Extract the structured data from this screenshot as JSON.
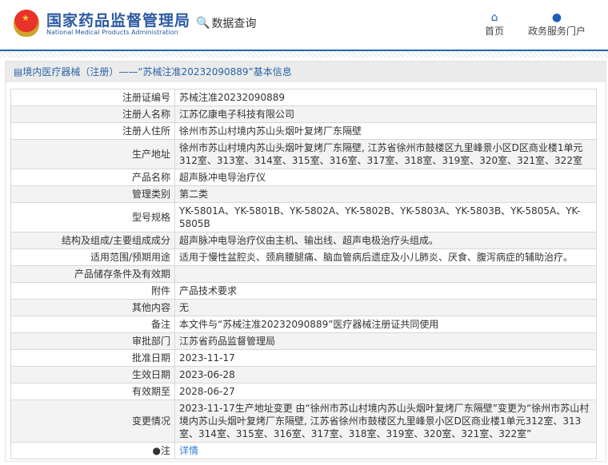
{
  "header": {
    "logo_cn": "国家药品监督管理局",
    "logo_en": "National Medical Products Administration",
    "data_query": "数据查询",
    "nav": [
      {
        "label": "首页",
        "icon": "home-icon"
      },
      {
        "label": "政务服务门户",
        "icon": "user-icon"
      }
    ]
  },
  "panel": {
    "title": "境内医疗器械（注册）——“苏械注准20232090889”基本信息"
  },
  "rows": [
    {
      "label": "注册证编号",
      "value": "苏械注准20232090889"
    },
    {
      "label": "注册人名称",
      "value": "江苏亿康电子科技有限公司"
    },
    {
      "label": "注册人住所",
      "value": "徐州市苏山村境内苏山头烟叶复烤厂东隔壁"
    },
    {
      "label": "生产地址",
      "value": "徐州市苏山村境内苏山头烟叶复烤厂东隔壁, 江苏省徐州市鼓楼区九里峰景小区D区商业楼1单元312室、313室、314室、315室、316室、317室、318室、319室、320室、321室、322室"
    },
    {
      "label": "产品名称",
      "value": "超声脉冲电导治疗仪"
    },
    {
      "label": "管理类别",
      "value": "第二类"
    },
    {
      "label": "型号规格",
      "value": "YK-5801A、YK-5801B、YK-5802A、YK-5802B、YK-5803A、YK-5803B、YK-5805A、YK-5805B"
    },
    {
      "label": "结构及组成/主要组成成分",
      "value": "超声脉冲电导治疗仪由主机、输出线、超声电极治疗头组成。"
    },
    {
      "label": "适用范围/预期用途",
      "value": "适用于慢性盆腔炎、颈肩腰腿痛、脑血管病后遗症及小儿肺炎、厌食、腹泻病症的辅助治疗。"
    },
    {
      "label": "产品储存条件及有效期",
      "value": ""
    },
    {
      "label": "附件",
      "value": "产品技术要求"
    },
    {
      "label": "其他内容",
      "value": "无"
    },
    {
      "label": "备注",
      "value": "本文件与“苏械注准20232090889”医疗器械注册证共同使用"
    },
    {
      "label": "审批部门",
      "value": "江苏省药品监督管理局"
    },
    {
      "label": "批准日期",
      "value": "2023-11-17"
    },
    {
      "label": "生效日期",
      "value": "2023-06-28"
    },
    {
      "label": "有效期至",
      "value": "2028-06-27"
    },
    {
      "label": "变更情况",
      "value": "2023-11-17生产地址变更 由“徐州市苏山村境内苏山头烟叶复烤厂东隔壁”变更为“徐州市苏山村境内苏山头烟叶复烤厂东隔壁, 江苏省徐州市鼓楼区九里峰景小区D区商业楼1单元312室、313室、314室、315室、316室、317室、318室、319室、320室、321室、322室”"
    }
  ],
  "note": {
    "label": "注",
    "link": "详情"
  }
}
